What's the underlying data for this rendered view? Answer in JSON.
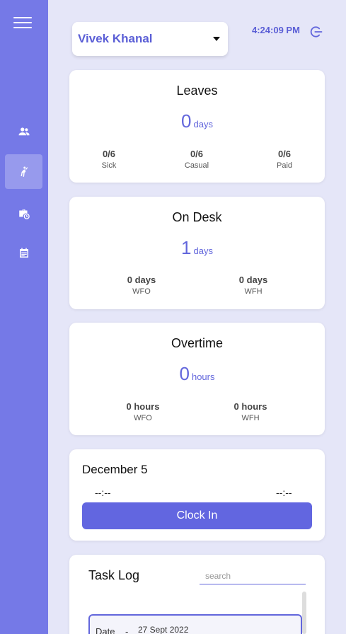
{
  "header": {
    "user_name": "Vivek Khanal",
    "time": "4:24:09 PM"
  },
  "leaves": {
    "title": "Leaves",
    "value": "0",
    "unit": "days",
    "stats": [
      {
        "value": "0/6",
        "label": "Sick"
      },
      {
        "value": "0/6",
        "label": "Casual"
      },
      {
        "value": "0/6",
        "label": "Paid"
      }
    ]
  },
  "on_desk": {
    "title": "On Desk",
    "value": "1",
    "unit": "days",
    "stats": [
      {
        "value": "0 days",
        "label": "WFO"
      },
      {
        "value": "0 days",
        "label": "WFH"
      }
    ]
  },
  "overtime": {
    "title": "Overtime",
    "value": "0",
    "unit": "hours",
    "stats": [
      {
        "value": "0 hours",
        "label": "WFO"
      },
      {
        "value": "0 hours",
        "label": "WFH"
      }
    ]
  },
  "attendance": {
    "date": "December 5",
    "clock_in_time": "--:--",
    "clock_out_time": "--:--",
    "button_label": "Clock In"
  },
  "task_log": {
    "title": "Task Log",
    "search_placeholder": "search",
    "entry": {
      "label": "Date",
      "separator": "-",
      "value": "27 Sept 2022"
    }
  },
  "colors": {
    "sidebar": "#7579e7",
    "accent": "#6266dc",
    "background": "#e5e6f8"
  },
  "icons": {
    "sidebar": [
      "menu-icon",
      "team-icon",
      "attendance-icon",
      "leave-icon",
      "calendar-icon"
    ],
    "header": [
      "dropdown-caret-icon",
      "logout-icon"
    ]
  }
}
